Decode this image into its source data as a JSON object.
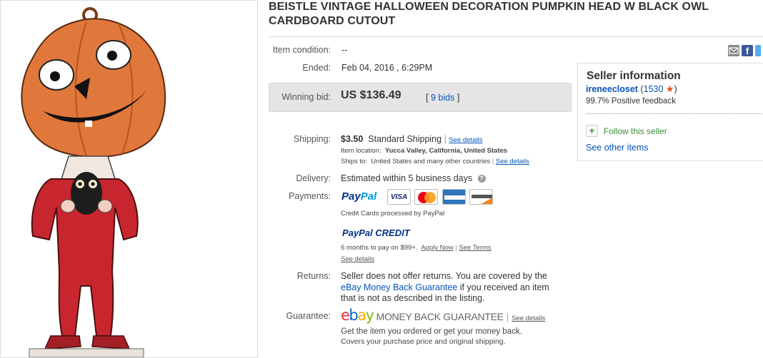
{
  "title": "BEISTLE VINTAGE HALLOWEEN DECORATION PUMPKIN HEAD W BLACK OWL CARDBOARD CUTOUT",
  "share_icons": [
    "email-icon",
    "facebook-icon",
    "twitter-icon"
  ],
  "item": {
    "condition_label": "Item condition:",
    "condition_value": "--",
    "ended_label": "Ended:",
    "ended_value": "Feb 04, 2016 , 6:29PM",
    "winning_bid_label": "Winning bid:",
    "winning_bid_value": "US $136.49",
    "bids_open": "[",
    "bids_link": "9 bids",
    "bids_close": "]"
  },
  "shipping": {
    "label": "Shipping:",
    "cost": "$3.50",
    "method": "Standard Shipping",
    "separator": "|",
    "see_details": "See details",
    "location_label": "Item location:",
    "location_value": "Yucca Valley, California, United States",
    "ships_to_label": "Ships to:",
    "ships_to_value": "United States and many other countries",
    "ships_to_sep": "|",
    "ships_to_see_details": "See details"
  },
  "delivery": {
    "label": "Delivery:",
    "value": "Estimated within 5 business days",
    "help_icon": "?"
  },
  "payments": {
    "label": "Payments:",
    "paypal_1": "Pay",
    "paypal_2": "Pal",
    "cards": [
      "VISA",
      "MasterCard",
      "AMERICAN EXPRESS",
      "DISCOVER"
    ],
    "processed_by": "Credit Cards processed by PayPal",
    "credit_logo": "PayPal CREDIT",
    "credit_text": "6 months to pay on $99+.",
    "apply_now": "Apply Now",
    "sep": "|",
    "see_terms": "See Terms",
    "see_details": "See details"
  },
  "returns": {
    "label": "Returns:",
    "text_1": "Seller does not offer returns. You are covered by the",
    "link": "eBay Money Back Guarantee",
    "text_2": " if you received an item",
    "text_3": "that is not as described in the listing."
  },
  "guarantee": {
    "label": "Guarantee:",
    "logo_letters": [
      "e",
      "b",
      "a",
      "y"
    ],
    "mbg": "MONEY BACK GUARANTEE",
    "sep": "|",
    "see_details": "See details",
    "line_1": "Get the item you ordered or get your money back.",
    "line_2": "Covers your purchase price and original shipping."
  },
  "seller": {
    "title": "Seller information",
    "name": "ireneecloset",
    "score_open": "(",
    "score": "1530",
    "score_close": ")",
    "feedback": "99.7% Positive feedback",
    "follow": "Follow this seller",
    "see_other": "See other items"
  },
  "colors": {
    "link": "#0654ba",
    "ebay_e": "#e53238",
    "ebay_b": "#0064d2",
    "ebay_a": "#f5af02",
    "ebay_y": "#86b817",
    "pumpkin": "#e0783c",
    "suit": "#c8262e",
    "star": "#e0531c"
  }
}
